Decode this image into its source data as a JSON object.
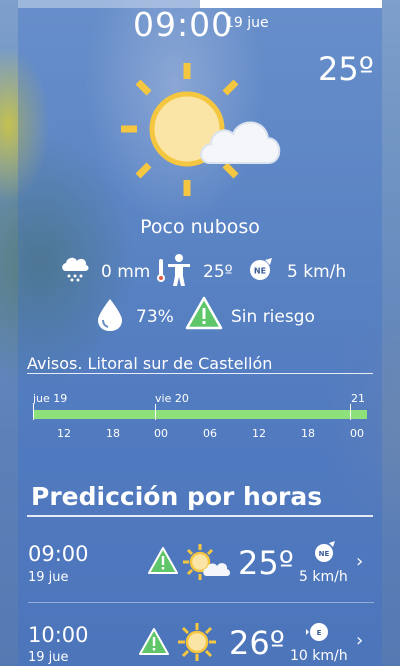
{
  "current": {
    "time": "09:00",
    "date": "19 jue",
    "temperature": "25º",
    "description": "Poco nuboso",
    "precipitation": "0 mm",
    "feels_like": "25º",
    "wind_dir": "NE",
    "wind_speed": "5 km/h",
    "humidity": "73%",
    "risk": "Sin riesgo"
  },
  "avisos": {
    "title": "Avisos. Litoral sur de Castellón",
    "days": [
      "jue 19",
      "vie 20",
      "21"
    ],
    "hours": [
      "12",
      "18",
      "00",
      "06",
      "12",
      "18",
      "00"
    ],
    "status_color": "#8ee07a"
  },
  "prediccion": {
    "title": "Predicción por horas",
    "rows": [
      {
        "time": "09:00",
        "date": "19 jue",
        "temp": "25º",
        "wind_dir": "NE",
        "wind_speed": "5 km/h"
      },
      {
        "time": "10:00",
        "date": "19 jue",
        "temp": "26º",
        "wind_dir": "E",
        "wind_speed": "10 km/h"
      }
    ]
  },
  "icons": {
    "weather": "sun-cloud-icon",
    "rain": "rain-cloud-icon",
    "thermo": "thermometer-person-icon",
    "wind": "wind-direction-icon",
    "humidity": "water-drop-icon",
    "warning": "warning-triangle-icon"
  },
  "colors": {
    "sun": "#f5c640",
    "warning_green": "#5fc66a"
  }
}
